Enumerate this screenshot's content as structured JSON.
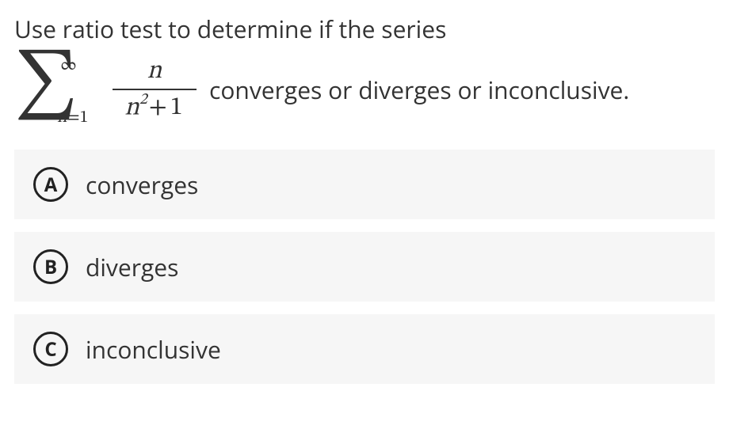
{
  "question": {
    "line1": "Use ratio test to determine if the series",
    "sigma_upper": "∞",
    "sigma_lower_var": "n",
    "sigma_lower_eq": "=",
    "sigma_lower_val": "1",
    "frac_num": "n",
    "frac_den_var": "n",
    "frac_den_exp": "2",
    "frac_den_plus": "+",
    "frac_den_const": "1",
    "tail": "converges or diverges or inconclusive."
  },
  "options": [
    {
      "key": "A",
      "label": "converges"
    },
    {
      "key": "B",
      "label": "diverges"
    },
    {
      "key": "C",
      "label": "inconclusive"
    }
  ]
}
